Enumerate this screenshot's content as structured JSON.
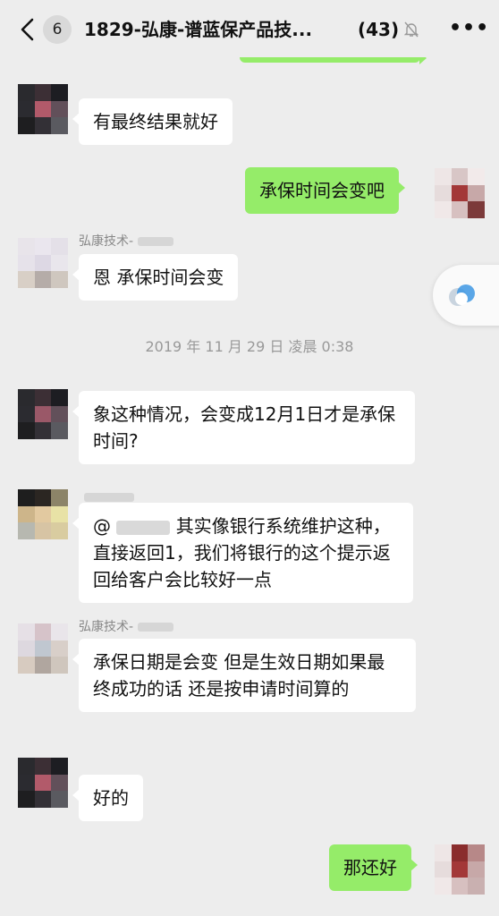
{
  "header": {
    "unread_count": "6",
    "title": "1829-弘康-谱蓝保产品技...",
    "member_count": "(43)"
  },
  "messages": [
    {
      "side": "left",
      "text": "有最终结果就好"
    },
    {
      "side": "right",
      "text": "承保时间会变吧"
    },
    {
      "side": "left",
      "sender": "弘康技术-",
      "text": "恩  承保时间会变"
    },
    {
      "type": "time",
      "text": "2019 年 11 月 29 日  凌晨 0:38"
    },
    {
      "side": "left",
      "text": "象这种情况，会变成12月1日才是承保时间?"
    },
    {
      "side": "left",
      "text_prefix": "@",
      "text": "其实像银行系统维护这种，直接返回1，我们将银行的这个提示返回给客户会比较好一点"
    },
    {
      "side": "left",
      "sender": "弘康技术-",
      "text": "承保日期是会变   但是生效日期如果最终成功的话   还是按申请时间算的"
    },
    {
      "side": "left",
      "text": "好的"
    },
    {
      "side": "right",
      "text": "那还好"
    }
  ],
  "colors": {
    "background": "#ededed",
    "my_bubble": "#95ec69",
    "other_bubble": "#ffffff"
  },
  "icons": [
    "back-icon",
    "mute-icon",
    "more-icon",
    "floating-ball-icon"
  ]
}
